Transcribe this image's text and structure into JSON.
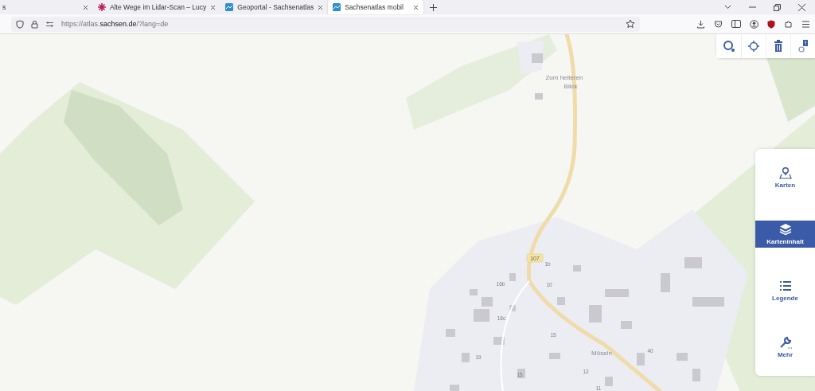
{
  "browser": {
    "tabs": [
      {
        "label": "s",
        "selected": false
      },
      {
        "label": "Alte Wege im Lidar-Scan – Lucy",
        "selected": false
      },
      {
        "label": "Geoportal - Sachsenatlas",
        "selected": false
      },
      {
        "label": "Sachsenatlas mobil",
        "selected": true
      }
    ],
    "url": "https://atlas.**sachsen.de**/?lang=de"
  },
  "map": {
    "labels": [
      {
        "kind": "place",
        "text": "Zum heiteren"
      },
      {
        "kind": "place",
        "text": "Blick"
      },
      {
        "kind": "road",
        "text": "107"
      },
      {
        "kind": "place",
        "text": "Möseln"
      },
      {
        "kind": "number",
        "text": "16b"
      },
      {
        "kind": "number",
        "text": "16c"
      },
      {
        "kind": "number",
        "text": "1b"
      },
      {
        "kind": "number",
        "text": "10"
      },
      {
        "kind": "number",
        "text": "15"
      },
      {
        "kind": "number",
        "text": "19"
      },
      {
        "kind": "number",
        "text": "15"
      },
      {
        "kind": "number",
        "text": "12"
      },
      {
        "kind": "number",
        "text": "11"
      },
      {
        "kind": "number",
        "text": "40"
      }
    ]
  },
  "toolbar": {
    "tools": [
      {
        "kind": "search"
      },
      {
        "kind": "locate"
      },
      {
        "kind": "delete"
      },
      {
        "kind": "info"
      }
    ]
  },
  "menu": {
    "items": [
      {
        "kind": "maps",
        "label": "Karten",
        "selected": false
      },
      {
        "kind": "layers",
        "label": "Karteninhalt",
        "selected": true
      },
      {
        "kind": "legend",
        "label": "Legende",
        "selected": false
      },
      {
        "kind": "more",
        "label": "Mehr",
        "selected": false
      }
    ]
  }
}
